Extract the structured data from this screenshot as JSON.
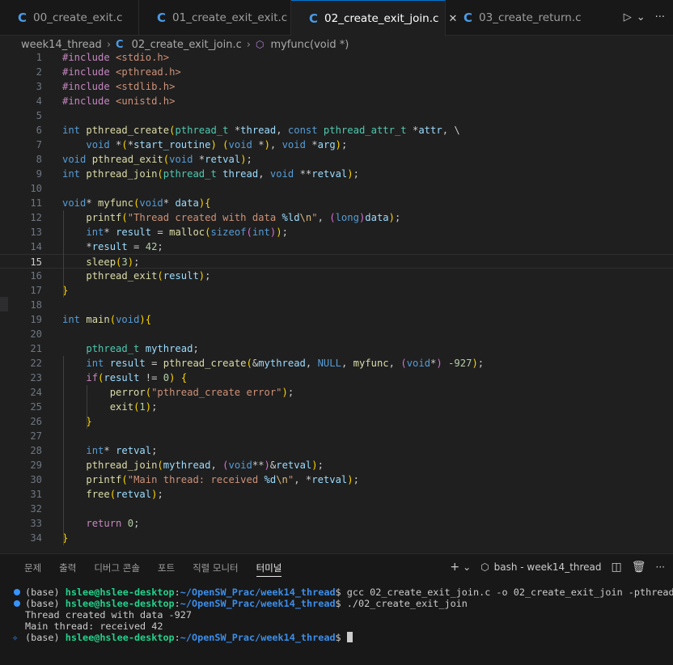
{
  "tabs": [
    {
      "label": "00_create_exit.c",
      "active": false
    },
    {
      "label": "01_create_exit_exit.c",
      "active": false
    },
    {
      "label": "02_create_exit_join.c",
      "active": true
    },
    {
      "label": "03_create_return.c",
      "active": false
    }
  ],
  "breadcrumb": {
    "folder": "week14_thread",
    "file": "02_create_exit_join.c",
    "symbol": "myfunc(void *)"
  },
  "editor": {
    "current_line": 15,
    "line_numbers": [
      "1",
      "2",
      "3",
      "4",
      "5",
      "6",
      "7",
      "8",
      "9",
      "10",
      "11",
      "12",
      "13",
      "14",
      "15",
      "16",
      "17",
      "18",
      "19",
      "20",
      "21",
      "22",
      "23",
      "24",
      "25",
      "26",
      "27",
      "28",
      "29",
      "30",
      "31",
      "32",
      "33",
      "34"
    ],
    "lines": [
      "#include <stdio.h>",
      "#include <pthread.h>",
      "#include <stdlib.h>",
      "#include <unistd.h>",
      "",
      "int pthread_create(pthread_t *thread, const pthread_attr_t *attr, \\",
      "    void *(*start_routine) (void *), void *arg);",
      "void pthread_exit(void *retval);",
      "int pthread_join(pthread_t thread, void **retval);",
      "",
      "void* myfunc(void* data){",
      "    printf(\"Thread created with data %ld\\n\", (long)data);",
      "    int* result = malloc(sizeof(int));",
      "    *result = 42;",
      "    sleep(3);",
      "    pthread_exit(result);",
      "}",
      "",
      "int main(void){",
      "",
      "    pthread_t mythread;",
      "    int result = pthread_create(&mythread, NULL, myfunc, (void*) -927);",
      "    if(result != 0) {",
      "        perror(\"pthread_create error\");",
      "        exit(1);",
      "    }",
      "",
      "    int* retval;",
      "    pthread_join(mythread, (void**)&retval);",
      "    printf(\"Main thread: received %d\\n\", *retval);",
      "    free(retval);",
      "",
      "    return 0;",
      "}"
    ]
  },
  "panel": {
    "tabs": [
      "문제",
      "출력",
      "디버그 콘솔",
      "포트",
      "직렬 모니터",
      "터미널"
    ],
    "active_tab": "터미널",
    "terminal_name": "bash - week14_thread",
    "terminal": [
      {
        "marker": "dot",
        "env": "(base) ",
        "user": "hslee@hslee-desktop",
        "colon": ":",
        "path": "~/OpenSW_Prac/week14_thread",
        "prompt": "$ ",
        "cmd": "gcc 02_create_exit_join.c -o 02_create_exit_join -pthread"
      },
      {
        "marker": "dot",
        "env": "(base) ",
        "user": "hslee@hslee-desktop",
        "colon": ":",
        "path": "~/OpenSW_Prac/week14_thread",
        "prompt": "$ ",
        "cmd": "./02_create_exit_join"
      },
      {
        "marker": "none",
        "text": "Thread created with data -927"
      },
      {
        "marker": "none",
        "text": "Main thread: received 42"
      },
      {
        "marker": "spark",
        "env": "(base) ",
        "user": "hslee@hslee-desktop",
        "colon": ":",
        "path": "~/OpenSW_Prac/week14_thread",
        "prompt": "$ ",
        "cmd": ""
      }
    ]
  },
  "colors": {
    "accent": "#0078d4",
    "c_icon": "#4a9be8",
    "terminal_user": "#23d18b",
    "terminal_path": "#3b8eea"
  }
}
